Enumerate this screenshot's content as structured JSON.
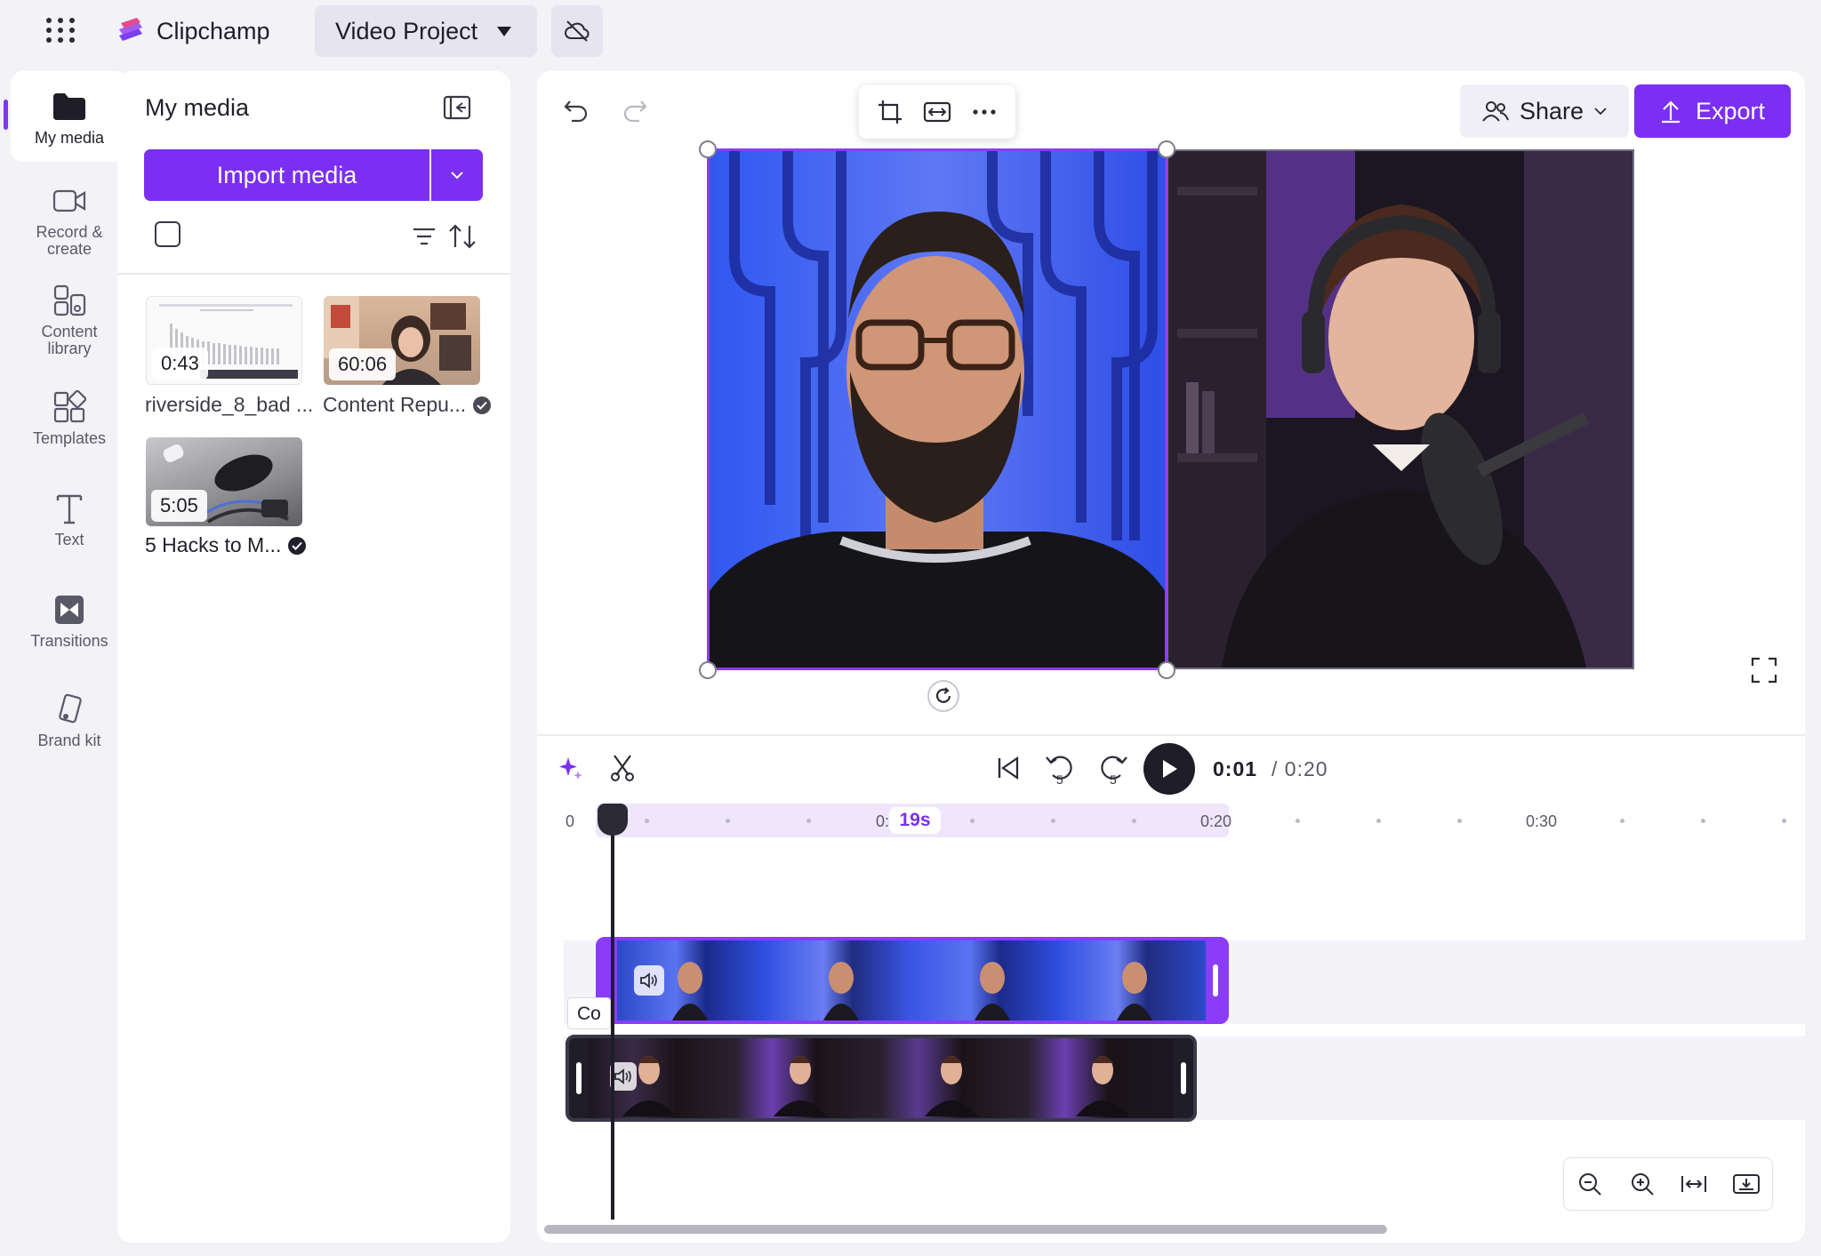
{
  "app": {
    "name": "Clipchamp",
    "project_name": "Video Project"
  },
  "colors": {
    "accent": "#7b2ff2",
    "background": "#f3f2f7"
  },
  "nav": {
    "items": [
      {
        "label": "My media",
        "icon": "folder-icon",
        "active": true
      },
      {
        "label": "Record & create",
        "icon": "camera-icon",
        "active": false
      },
      {
        "label": "Content library",
        "icon": "library-icon",
        "active": false
      },
      {
        "label": "Templates",
        "icon": "templates-icon",
        "active": false
      },
      {
        "label": "Text",
        "icon": "text-icon",
        "active": false
      },
      {
        "label": "Transitions",
        "icon": "transitions-icon",
        "active": false
      },
      {
        "label": "Brand kit",
        "icon": "brand-kit-icon",
        "active": false
      }
    ]
  },
  "media_panel": {
    "title": "My media",
    "import_label": "Import media",
    "items": [
      {
        "duration": "0:43",
        "name": "riverside_8_bad ...",
        "verified": false
      },
      {
        "duration": "60:06",
        "name": "Content Repu...",
        "verified": true
      },
      {
        "duration": "5:05",
        "name": "5 Hacks to M...",
        "verified": true
      }
    ]
  },
  "toolbar": {
    "share_label": "Share",
    "export_label": "Export"
  },
  "playback": {
    "current_time": "0:01",
    "total_time": "/ 0:20",
    "skip_back_seconds": "5",
    "skip_forward_seconds": "5"
  },
  "timeline": {
    "ruler_labels": [
      "0",
      "0:",
      "0:20",
      "0:30"
    ],
    "hover_time": "19s",
    "clip_label": "Co"
  }
}
